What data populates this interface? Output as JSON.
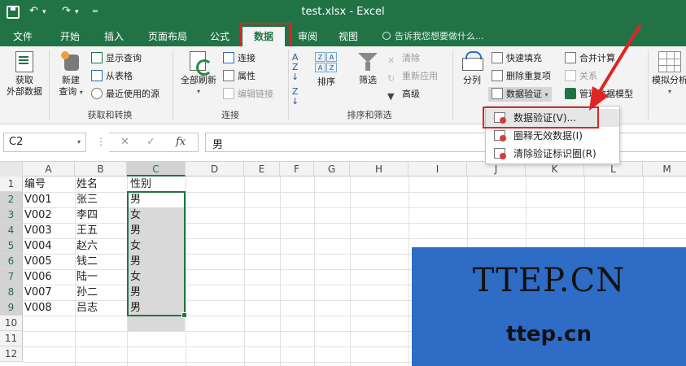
{
  "window": {
    "title": "test.xlsx  -  Excel"
  },
  "tabs": [
    {
      "label": "文件"
    },
    {
      "label": "开始"
    },
    {
      "label": "插入"
    },
    {
      "label": "页面布局"
    },
    {
      "label": "公式"
    },
    {
      "label": "数据"
    },
    {
      "label": "审阅"
    },
    {
      "label": "视图"
    }
  ],
  "tell_me": "告诉我您想要做什么...",
  "ribbon": {
    "get_external_1": "获取",
    "get_external_2": "外部数据",
    "new_query_1": "新建",
    "new_query_2": "查询",
    "show_queries": "显示查询",
    "from_table": "从表格",
    "recent_sources": "最近使用的源",
    "group_get_transform": "获取和转换",
    "refresh_all": "全部刷新",
    "connections": "连接",
    "properties": "属性",
    "edit_links": "编辑链接",
    "group_connections": "连接",
    "sort": "排序",
    "filter": "筛选",
    "clear": "清除",
    "reapply": "重新应用",
    "advanced": "高级",
    "group_sort_filter": "排序和筛选",
    "text_to_columns": "分列",
    "flash_fill": "快速填充",
    "remove_duplicates": "删除重复项",
    "data_validation": "数据验证",
    "consolidate": "合并计算",
    "relationships": "关系",
    "manage_data_model": "管理数据模型",
    "what_if_analysis": "模拟分析"
  },
  "formula_bar": {
    "name_box": "C2",
    "value": "男",
    "fx": "fx"
  },
  "columns": [
    "A",
    "B",
    "C",
    "D",
    "E",
    "F",
    "G",
    "H",
    "I",
    "J",
    "K",
    "L",
    "M"
  ],
  "rows": [
    "1",
    "2",
    "3",
    "4",
    "5",
    "6",
    "7",
    "8",
    "9",
    "10",
    "11",
    "12"
  ],
  "table": {
    "headers": [
      "编号",
      "姓名",
      "性别"
    ],
    "rows": [
      [
        "V001",
        "张三",
        "男"
      ],
      [
        "V002",
        "李四",
        "女"
      ],
      [
        "V003",
        "王五",
        "男"
      ],
      [
        "V004",
        "赵六",
        "女"
      ],
      [
        "V005",
        "钱二",
        "男"
      ],
      [
        "V006",
        "陆一",
        "女"
      ],
      [
        "V007",
        "孙二",
        "男"
      ],
      [
        "V008",
        "吕志",
        "男"
      ]
    ]
  },
  "dropdown_menu": {
    "items": [
      {
        "label": "数据验证(V)..."
      },
      {
        "label": "圈释无效数据(I)"
      },
      {
        "label": "清除验证标识圈(R)"
      }
    ]
  },
  "watermark": {
    "big": "TTEP.CN",
    "small": "ttep.cn"
  },
  "colors": {
    "excel_green": "#217346",
    "highlight_red": "#e02424",
    "watermark_blue": "#2e6cc6"
  }
}
